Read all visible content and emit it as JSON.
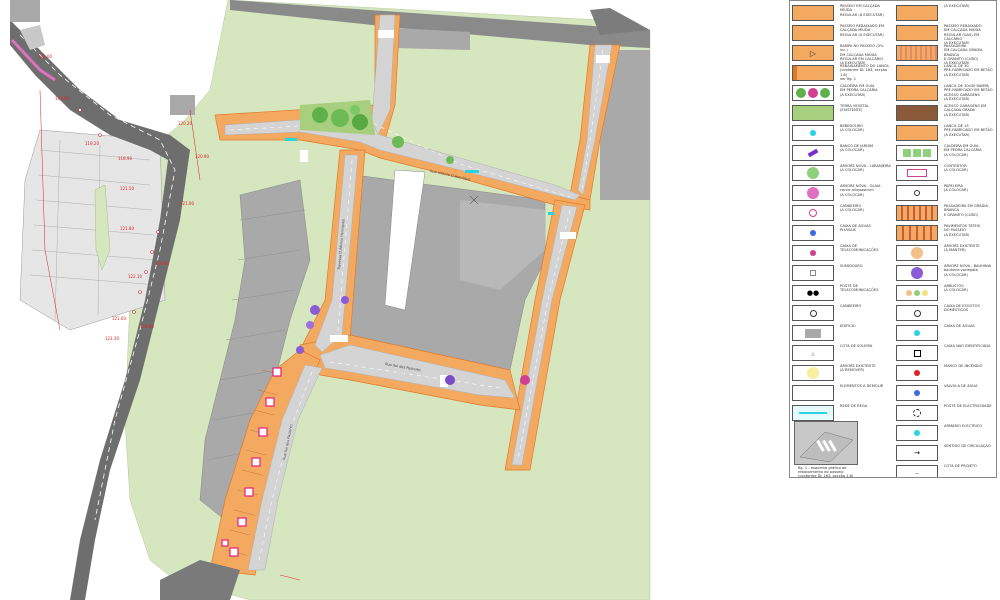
{
  "map": {
    "street_labels": [
      "Rua Infante D.Henrique",
      "Travessa D.Afonso Henriques",
      "Rua Sol dos Pastores",
      "Rua Sol dos Pastores"
    ],
    "elevation_labels": [
      "120.00",
      "119.50",
      "119.20",
      "118.90",
      "121.00",
      "121.50",
      "121.80",
      "122.10",
      "121.60",
      "121.30",
      "120.80",
      "120.20",
      "119.80",
      "120.90"
    ],
    "colors": {
      "sidewalk": "#f4a960",
      "roadway": "#d4d4d4",
      "building": "#a9a9a9",
      "green_space": "#d6e6bf",
      "existing_road": "#6e6e6e",
      "curb": "#e07a2a"
    }
  },
  "legend": {
    "left": [
      {
        "label": "PASSEIO EM CALÇADA MIÚDA\nREGULAR (A EXECUTAR)",
        "symbol": "sidewalk"
      },
      {
        "label": "PASSEIO REBAIXADO EM CALÇADA MIÚDA\nREGULAR (A EXECUTAR)",
        "symbol": "sidewalk"
      },
      {
        "label": "RAMPA NO PASSEIO (3% inc.)\nEM CALÇADA MIÚDA\nREGULAR EM CALCÁRIO\n(A EXECUTAR)",
        "symbol": "ramp"
      },
      {
        "label": "REBAIXAMENTO DO LANCIL\n(conforme DL 163, secção 1.6)\nver fig. 1",
        "symbol": "curb"
      },
      {
        "label": "CALDEIRA EM GUIA\nEM PEDRA CALCÁRIA\n(A EXECUTAR)",
        "symbol": "trees"
      },
      {
        "label": "TERRA VEGETAL\n(EXISTENTE)",
        "symbol": "green"
      },
      {
        "label": "BEBEDOURO\n(A COLOCAR)",
        "symbol": "cyan-dot"
      },
      {
        "label": "BANCO DE JARDIM\n(A COLOCAR)",
        "symbol": "bench"
      },
      {
        "label": "ÁRVORE NOVA - LARANJEIRA\n(A COLOCAR)",
        "symbol": "tree-green"
      },
      {
        "label": "ÁRVORE NOVA - OLAIA\ncercis siliquastrum\n(A COLOCAR)",
        "symbol": "tree-pink"
      },
      {
        "label": "CANDEEIRO\n(A COLOCAR)",
        "symbol": "lamp"
      },
      {
        "label": "CAIXA DE ÁGUAS\nPLUVIAIS",
        "symbol": "drain"
      },
      {
        "label": "CAIXA DE\nTELECOMUNICAÇÕES",
        "symbol": "pink-dot"
      },
      {
        "label": "SUMIDOURO",
        "symbol": "square"
      },
      {
        "label": "POSTE DE\nTELECOMUNICAÇÕES",
        "symbol": "pole"
      },
      {
        "label": "CANDEEIRO",
        "symbol": "circle"
      },
      {
        "label": "EDIFÍCIO",
        "symbol": "building"
      },
      {
        "label": "COTA DE SOLEIRA",
        "symbol": "text-small"
      },
      {
        "label": "ÁRVORE EXISTENTE\n(A REMOVER)",
        "symbol": "tree-yellow"
      },
      {
        "label": "ELEMENTOS A DEMOLIR",
        "symbol": "empty"
      },
      {
        "label": "REDE DE REGA",
        "symbol": "cyan-text"
      }
    ],
    "right": [
      {
        "label": "(A EXECUTAR)",
        "symbol": "sidewalk"
      },
      {
        "label": "PASSEIO REBAIXADO\nEM CALÇADA MIÚDA\nREGULAR (GAS) EM CALCÁRIO\n(A EXECUTAR)",
        "symbol": "sidewalk"
      },
      {
        "label": "PASSADEIRA\nEM CALÇADA GRADIA BRANCA\nE GRANITO (CUBO)\n(A EXECUTAR)",
        "symbol": "crosswalk"
      },
      {
        "label": "LANCIL DE 30\nPRÉ-FABRICADO EM BETÃO\n(A EXECUTAR)",
        "symbol": "sidewalk"
      },
      {
        "label": "LANCIL DE 30x30 RAMPA\nPRÉ-FABRICADO EM BETÃO\nACESSO GARAGENS\n(A EXECUTAR)",
        "symbol": "sidewalk"
      },
      {
        "label": "ACESSO GARAGENS EM\nCALÇADA GRADA\n(A EXECUTAR)",
        "symbol": "dotted"
      },
      {
        "label": "LANCIL DE 15\nPRÉ-FABRICADO EM BETÃO\n(A EXECUTAR)",
        "symbol": "sidewalk"
      },
      {
        "label": "CALDEIRA EM GUIA\nEM PEDRA CALCÁRIA\n(A COLOCAR)",
        "symbol": "tree-boxes"
      },
      {
        "label": "CONTENTOR\n(A COLOCAR)",
        "symbol": "container"
      },
      {
        "label": "PAPELEIRA\n(A COLOCAR)",
        "symbol": "circle-small"
      },
      {
        "label": "PASSADEIRA EM GRADIA BRANCA\nE GRANITO (CUBO)",
        "symbol": "crosswalk-full"
      },
      {
        "label": "PAVIMENTOS TÁTEIS\nNO PASSEIO\n(A EXECUTAR)",
        "symbol": "tactile"
      },
      {
        "label": "ÁRVORE EXISTENTE\n(A MANTER)",
        "symbol": "tree-orange"
      },
      {
        "label": "ÁRVORE NOVA - BAUHINIA\nbauhinia variegata\n(A COLOCAR)",
        "symbol": "tree-purple"
      },
      {
        "label": "ARBUSTOS\n(A COLOCAR)",
        "symbol": "shrubs"
      },
      {
        "label": "CAIXA DE ESGOTOS\nDOMÉSTICOS",
        "symbol": "circle"
      },
      {
        "label": "CAIXA DE ÁGUAS",
        "symbol": "cyan-dot"
      },
      {
        "label": "CAIXA NÃO IDENTIFICADA",
        "symbol": "box-black"
      },
      {
        "label": "MARCO DE INCÊNDIO",
        "symbol": "red-dot"
      },
      {
        "label": "VÁLVULA DE ÁGUA",
        "symbol": "valve"
      },
      {
        "label": "POSTE DE ELECTRICIDADE",
        "symbol": "dash-circle"
      },
      {
        "label": "ARMÁRIO ELÉCTRICO",
        "symbol": "cyan-dot"
      },
      {
        "label": "SENTIDO DE CIRCULAÇÃO",
        "symbol": "arrow"
      },
      {
        "label": "COTA DE PROJETO",
        "symbol": "cota"
      }
    ],
    "figure_caption": "fig. 1 - esquema gráfico de\nrebaixamento do passeio\n(conforme DL 163, secção 1.6)"
  }
}
